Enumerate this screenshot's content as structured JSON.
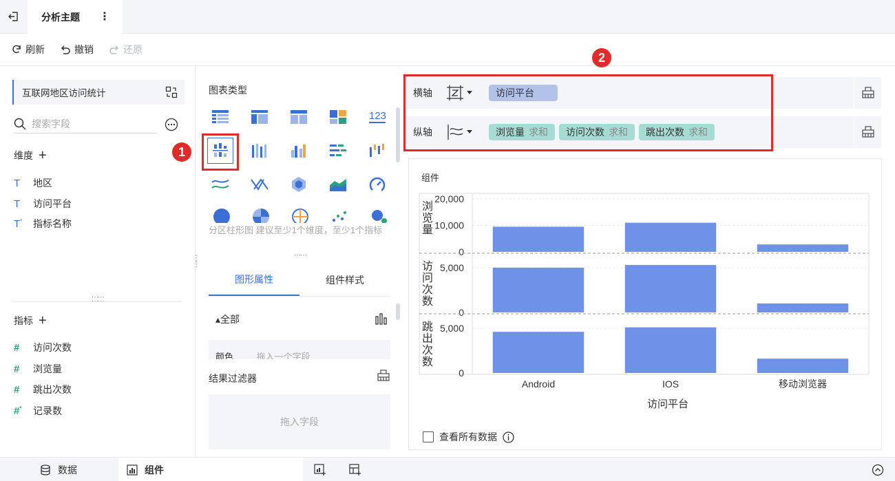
{
  "header": {
    "title": "分析主题"
  },
  "toolbar": {
    "refresh": "刷新",
    "undo": "撤销",
    "redo": "还原"
  },
  "sidebar": {
    "dataset": "互联网地区访问统计",
    "search_placeholder": "搜索字段",
    "dimensions_title": "维度",
    "dimensions": [
      "地区",
      "访问平台",
      "指标名称"
    ],
    "measures_title": "指标",
    "measures": [
      "访问次数",
      "浏览量",
      "跳出次数",
      "记录数"
    ]
  },
  "chart_types": {
    "title": "图表类型",
    "hint": "分区柱形图 建议至少1个维度，至少1个指标"
  },
  "props": {
    "tab_shape": "图形属性",
    "tab_style": "组件样式",
    "all_label": "全部",
    "color_label": "颜色",
    "color_drop": "拖入一个字段",
    "filter_title": "结果过滤器",
    "filter_drop": "拖入字段"
  },
  "axes": {
    "x_label": "横轴",
    "x_fields": [
      "访问平台"
    ],
    "y_label": "纵轴",
    "y_fields": [
      {
        "name": "浏览量",
        "agg": "求和"
      },
      {
        "name": "访问次数",
        "agg": "求和"
      },
      {
        "name": "跳出次数",
        "agg": "求和"
      }
    ]
  },
  "annotations": {
    "badge1": "1",
    "badge2": "2"
  },
  "component": {
    "name": "组件",
    "view_all": "查看所有数据"
  },
  "bottom": {
    "data_tab": "数据",
    "component_tab": "组件"
  },
  "colors": {
    "accent": "#3a6fd8",
    "bar": "#6f91e8",
    "highlight": "#e02b2b"
  },
  "chart_data": {
    "type": "bar",
    "categories": [
      "Android",
      "IOS",
      "移动浏览器"
    ],
    "xlabel": "访问平台",
    "series": [
      {
        "name": "浏览量",
        "values": [
          9500,
          11000,
          2800
        ],
        "ylim": [
          0,
          20000
        ],
        "ticks": [
          "20,000",
          "10,000",
          "0"
        ]
      },
      {
        "name": "访问次数",
        "values": [
          5000,
          5300,
          1000
        ],
        "ylim": [
          0,
          6000
        ],
        "ticks": [
          "5,000",
          "0"
        ]
      },
      {
        "name": "跳出次数",
        "values": [
          4600,
          5100,
          1600
        ],
        "ylim": [
          0,
          6000
        ],
        "ticks": [
          "5,000",
          "0"
        ]
      }
    ]
  }
}
